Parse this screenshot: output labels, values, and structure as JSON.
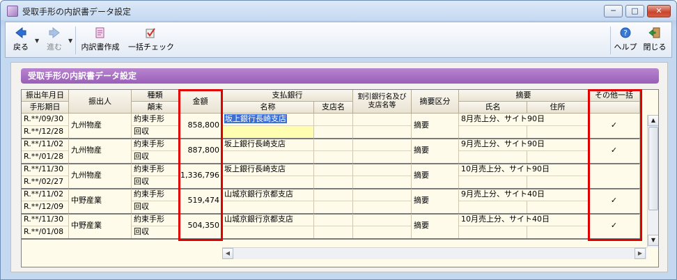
{
  "window": {
    "title": "受取手形の内訳書データ設定",
    "controls": {
      "minimize": "─",
      "maximize": "□",
      "close": "✕"
    }
  },
  "toolbar": {
    "back": "戻る",
    "forward": "進む",
    "create_breakdown": "内訳書作成",
    "bulk_check": "一括チェック",
    "help": "ヘルプ",
    "close": "閉じる"
  },
  "panel": {
    "title": "受取手形の内訳書データ設定"
  },
  "table": {
    "headers": {
      "issue_date": "振出年月日",
      "due_date": "手形期日",
      "issuer": "振出人",
      "kind": "種類",
      "period_end": "顛末",
      "amount": "金額",
      "bank": "支払銀行",
      "bank_name": "名称",
      "branch_name": "支店名",
      "discount_bank": "割引銀行名及び支店名等",
      "summary_category": "摘要区分",
      "summary": "摘要",
      "name": "氏名",
      "address": "住所",
      "other_bulk": "その他一括"
    },
    "rows": [
      {
        "issue_date": "R.**/09/30",
        "due_date": "R.**/12/28",
        "issuer": "九州物産",
        "kind": "約束手形",
        "period_end": "回収",
        "amount": "858,800",
        "bank_name": "坂上銀行長崎支店",
        "branch_name": "",
        "discount_bank": "",
        "summary_category": "摘要",
        "name_summary": "8月売上分、サイト90日",
        "address": "",
        "checked": "✓",
        "selected": true
      },
      {
        "issue_date": "R.**/11/02",
        "due_date": "R.**/01/28",
        "issuer": "九州物産",
        "kind": "約束手形",
        "period_end": "回収",
        "amount": "887,800",
        "bank_name": "坂上銀行長崎支店",
        "branch_name": "",
        "discount_bank": "",
        "summary_category": "摘要",
        "name_summary": "9月売上分、サイト90日",
        "address": "",
        "checked": "✓",
        "selected": false
      },
      {
        "issue_date": "R.**/11/30",
        "due_date": "R.**/02/27",
        "issuer": "九州物産",
        "kind": "約束手形",
        "period_end": "回収",
        "amount": "1,336,796",
        "bank_name": "坂上銀行長崎支店",
        "branch_name": "",
        "discount_bank": "",
        "summary_category": "摘要",
        "name_summary": "10月売上分、サイト90日",
        "address": "",
        "checked": "",
        "selected": false
      },
      {
        "issue_date": "R.**/11/02",
        "due_date": "R.**/12/09",
        "issuer": "中野産業",
        "kind": "約束手形",
        "period_end": "回収",
        "amount": "519,474",
        "bank_name": "山城京銀行京都支店",
        "branch_name": "",
        "discount_bank": "",
        "summary_category": "摘要",
        "name_summary": "9月売上分、サイト40日",
        "address": "",
        "checked": "✓",
        "selected": false
      },
      {
        "issue_date": "R.**/11/30",
        "due_date": "R.**/01/08",
        "issuer": "中野産業",
        "kind": "約束手形",
        "period_end": "回収",
        "amount": "504,350",
        "bank_name": "山城京銀行京都支店",
        "branch_name": "",
        "discount_bank": "",
        "summary_category": "摘要",
        "name_summary": "10月売上分、サイト40日",
        "address": "",
        "checked": "✓",
        "selected": false
      }
    ]
  },
  "icons": {
    "back": "back-arrow-icon",
    "forward": "forward-arrow-icon",
    "create": "document-create-icon",
    "check": "bulk-check-icon",
    "help": "help-icon",
    "close": "exit-door-icon"
  },
  "colors": {
    "header_purple": "#9a5fb8",
    "highlight_red": "#e00000",
    "selection_blue": "#3b6fd4",
    "grid_bg": "#fffbea"
  }
}
